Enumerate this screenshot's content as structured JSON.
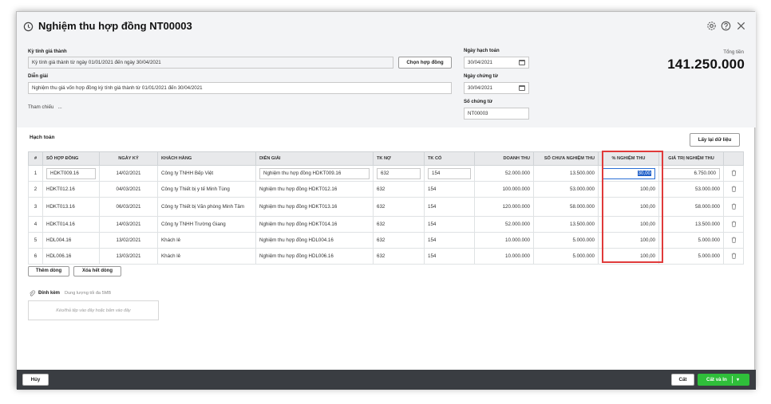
{
  "form": {
    "title": "Nghiệm thu hợp đồng NT00003",
    "period_label": "Kỳ tính giá thành",
    "period_value": "Kỳ tính giá thành từ ngày 01/01/2021 đến ngày 30/04/2021",
    "choose_contract": "Chọn hợp đồng",
    "description_label": "Diễn giải",
    "description_value": "Nghiệm thu giá vốn hợp đồng kỳ tính giá thành từ 01/01/2021 đến 30/04/2021",
    "reference_label": "Tham chiếu",
    "reference_more": "...",
    "posting_date_label": "Ngày hạch toán",
    "posting_date": "30/04/2021",
    "doc_date_label": "Ngày chứng từ",
    "doc_date": "30/04/2021",
    "doc_no_label": "Số chứng từ",
    "doc_no": "NT00003",
    "total_label": "Tổng tiền",
    "total_value": "141.250.000"
  },
  "icons": {
    "title": "history-icon",
    "settings": "gear-icon",
    "help": "help-icon",
    "close": "close-icon",
    "calendar": "calendar-icon",
    "trash": "trash-icon",
    "attach": "paperclip-icon",
    "dropdown": "chevron-down-icon"
  },
  "grid": {
    "section_title": "Hạch toán",
    "reload_button": "Lấy lại dữ liệu",
    "headers": [
      "#",
      "SỐ HỢP ĐỒNG",
      "NGÀY KÝ",
      "KHÁCH HÀNG",
      "DIỄN GIẢI",
      "TK NỢ",
      "TK CÓ",
      "DOANH THU",
      "SỐ CHƯA NGHIỆM THU",
      "% NGHIỆM THU",
      "GIÁ TRỊ NGHIỆM THU"
    ],
    "rows": [
      {
        "no": "1",
        "contract": "HDKT009.16",
        "date": "14/02/2021",
        "customer": "Công ty TNHH Bếp Việt",
        "desc": "Nghiệm thu hợp đồng  HDKT009.16",
        "debit": "632",
        "credit": "154",
        "revenue": "52.000.000",
        "remaining": "13.500.000",
        "percent": "30,00",
        "value": "6.750.000"
      },
      {
        "no": "2",
        "contract": "HDKT012.16",
        "date": "04/03/2021",
        "customer": "Công ty Thiết bị y tế Minh Tùng",
        "desc": "Nghiệm thu hợp đồng  HDKT012.16",
        "debit": "632",
        "credit": "154",
        "revenue": "100.000.000",
        "remaining": "53.000.000",
        "percent": "100,00",
        "value": "53.000.000"
      },
      {
        "no": "3",
        "contract": "HDKT013.16",
        "date": "06/03/2021",
        "customer": "Công ty Thiết bị Văn phòng Minh Tâm",
        "desc": "Nghiệm thu hợp đồng  HDKT013.16",
        "debit": "632",
        "credit": "154",
        "revenue": "120.000.000",
        "remaining": "58.000.000",
        "percent": "100,00",
        "value": "58.000.000"
      },
      {
        "no": "4",
        "contract": "HDKT014.16",
        "date": "14/03/2021",
        "customer": "Công ty TNHH Trường Giang",
        "desc": "Nghiệm thu hợp đồng  HDKT014.16",
        "debit": "632",
        "credit": "154",
        "revenue": "52.000.000",
        "remaining": "13.500.000",
        "percent": "100,00",
        "value": "13.500.000"
      },
      {
        "no": "5",
        "contract": "HDL004.16",
        "date": "13/02/2021",
        "customer": "Khách lẻ",
        "desc": "Nghiệm thu hợp đồng  HDL004.16",
        "debit": "632",
        "credit": "154",
        "revenue": "10.000.000",
        "remaining": "5.000.000",
        "percent": "100,00",
        "value": "5.000.000"
      },
      {
        "no": "6",
        "contract": "HDL006.16",
        "date": "13/03/2021",
        "customer": "Khách lẻ",
        "desc": "Nghiệm thu hợp đồng  HDL006.16",
        "debit": "632",
        "credit": "154",
        "revenue": "10.000.000",
        "remaining": "5.000.000",
        "percent": "100,00",
        "value": "5.000.000"
      }
    ],
    "add_row": "Thêm dòng",
    "delete_all": "Xóa hết dòng"
  },
  "attachment": {
    "title": "Đính kèm",
    "note": "Dung lượng tối đa 5MB",
    "drop_hint": "Kéo/thả tệp vào đây hoặc bấm vào đây"
  },
  "footer": {
    "cancel": "Hủy",
    "save": "Cất",
    "save_and_add": "Cất và In"
  },
  "colors": {
    "highlight_border": "#e03a3a",
    "primary_green": "#2fbf3a",
    "footer_bg": "#3a3d42",
    "selection": "#1f5fc8"
  }
}
